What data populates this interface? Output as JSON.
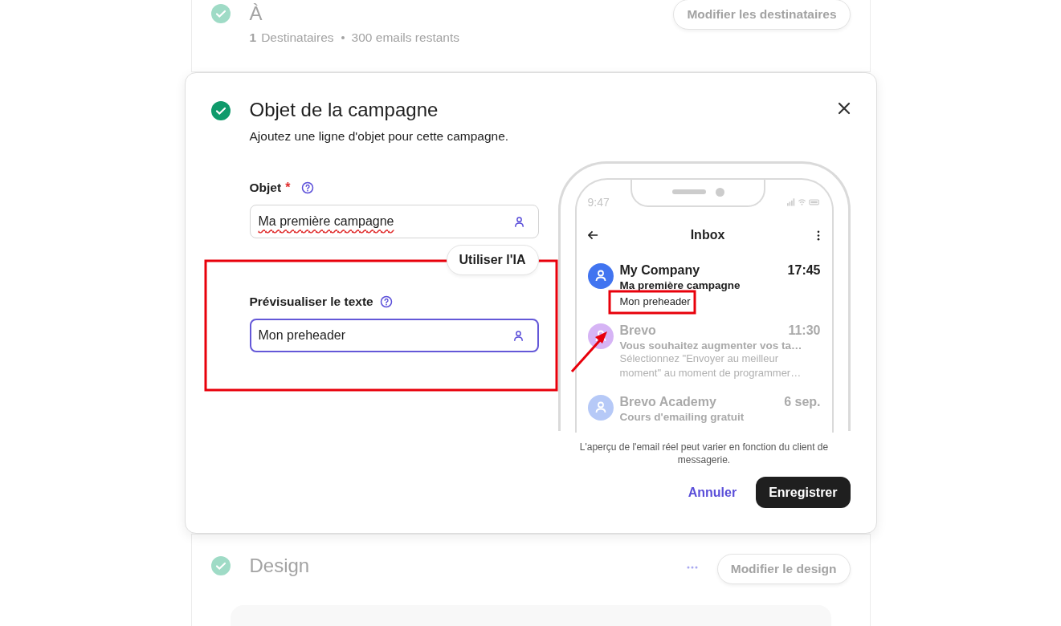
{
  "recipients_step": {
    "done": true,
    "title": "À",
    "count": "1",
    "count_label": "Destinataires",
    "remaining": "300 emails restants",
    "button": "Modifier les destinataires"
  },
  "subject_step": {
    "done": true,
    "title": "Objet de la campagne",
    "description": "Ajoutez une ligne d'objet pour cette campagne.",
    "fields": [
      {
        "label": "Objet",
        "required_mark": "*",
        "value": "Ma première campagne",
        "focused": false
      },
      {
        "label": "Prévisualiser le texte",
        "value": "Mon preheader",
        "focused": true
      }
    ],
    "ai_button": "Utiliser l'IA",
    "preview": {
      "clock": "9:47",
      "title": "Inbox",
      "emails": [
        {
          "sender": "My Company",
          "time": "17:45",
          "subject": "Ma première campagne",
          "snippet": "Mon preheader",
          "unread": true,
          "color": "#4174f0"
        },
        {
          "sender": "Brevo",
          "time": "11:30",
          "subject": "Vous souhaitez augmenter vos ta…",
          "snippet": "Sélectionnez \"Envoyer au meilleur moment\" au moment de programmer…",
          "unread": false,
          "color": "#d6b4f5"
        },
        {
          "sender": "Brevo Academy",
          "time": "6 sep.",
          "subject": "Cours d'emailing gratuit",
          "unread": false,
          "color": "#b6c9f7"
        }
      ]
    },
    "disclaimer": "L'aperçu de l'email réel peut varier en fonction du client de messagerie.",
    "cancel": "Annuler",
    "save": "Enregistrer"
  },
  "design_step": {
    "done": true,
    "title": "Design",
    "button": "Modifier le design"
  }
}
